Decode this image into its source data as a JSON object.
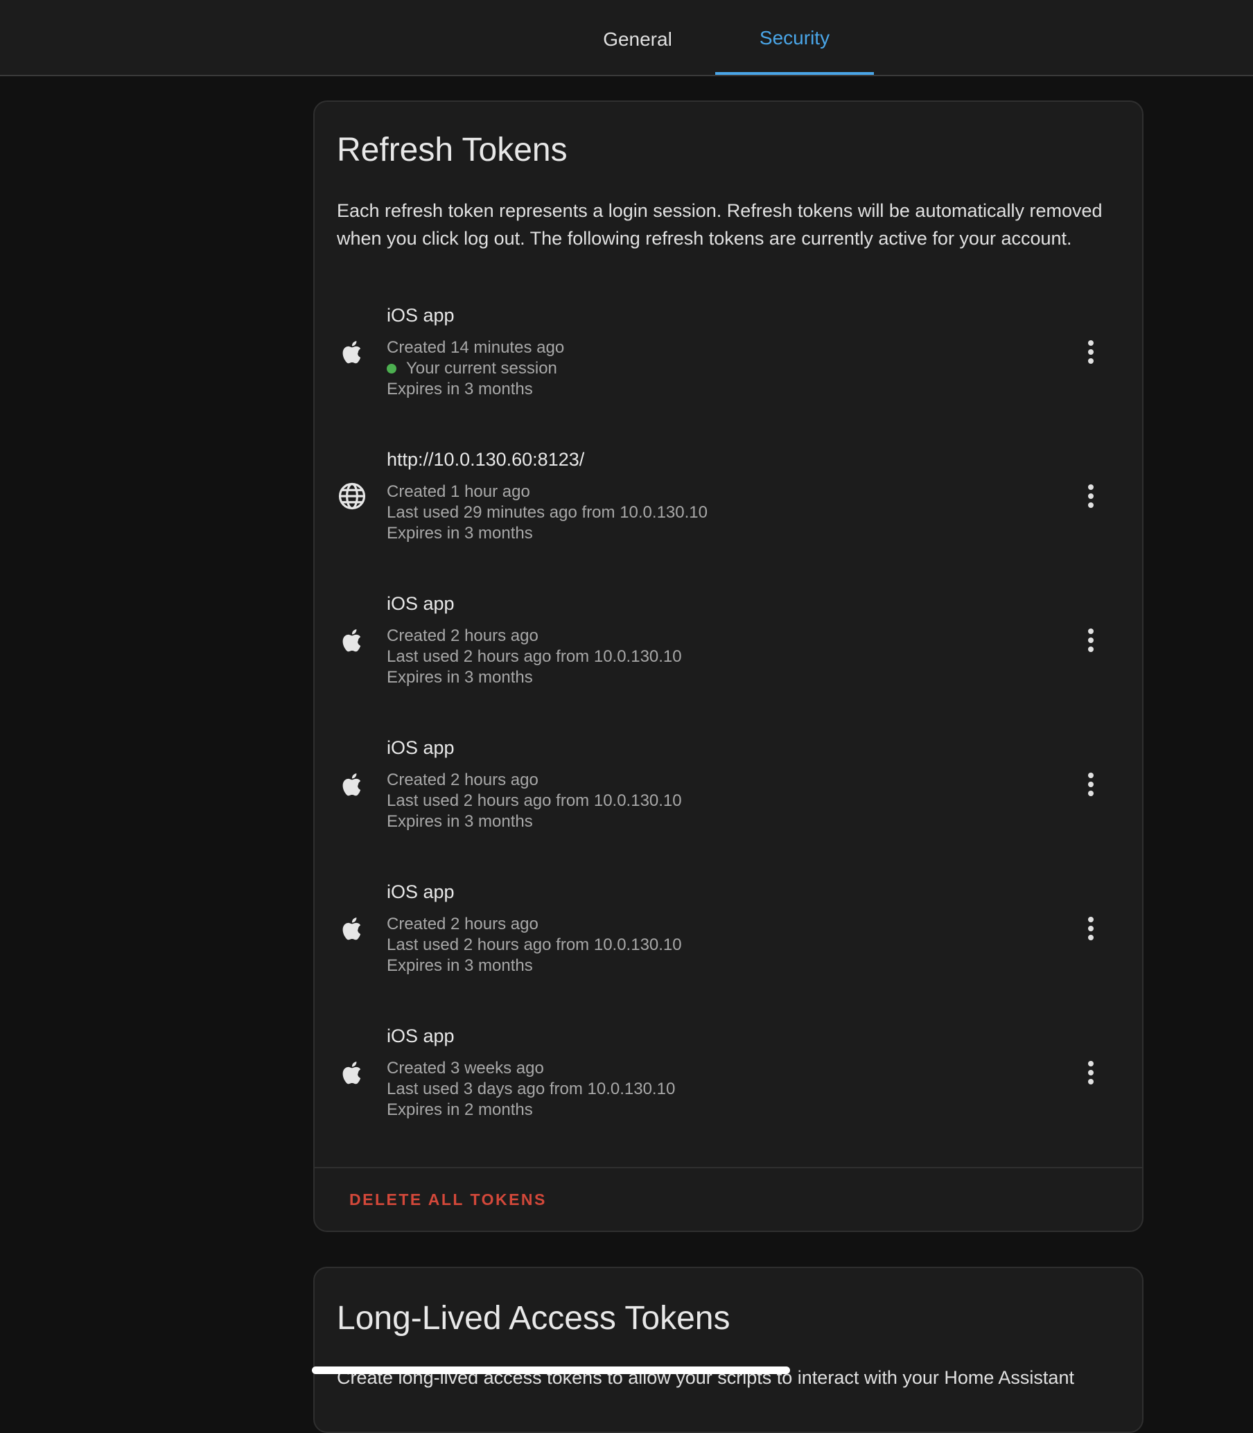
{
  "tabs": {
    "general": "General",
    "security": "Security"
  },
  "refresh_tokens": {
    "title": "Refresh Tokens",
    "description": "Each refresh token represents a login session. Refresh tokens will be automatically removed when you click log out. The following refresh tokens are currently active for your account.",
    "tokens": [
      {
        "icon": "apple-icon",
        "name": "iOS app",
        "created": "Created 14 minutes ago",
        "current_session": "Your current session",
        "expires": "Expires in 3 months"
      },
      {
        "icon": "globe-icon",
        "name": "http://10.0.130.60:8123/",
        "created": "Created 1 hour ago",
        "last_used": "Last used 29 minutes ago from 10.0.130.10",
        "expires": "Expires in 3 months"
      },
      {
        "icon": "apple-icon",
        "name": "iOS app",
        "created": "Created 2 hours ago",
        "last_used": "Last used 2 hours ago from 10.0.130.10",
        "expires": "Expires in 3 months"
      },
      {
        "icon": "apple-icon",
        "name": "iOS app",
        "created": "Created 2 hours ago",
        "last_used": "Last used 2 hours ago from 10.0.130.10",
        "expires": "Expires in 3 months"
      },
      {
        "icon": "apple-icon",
        "name": "iOS app",
        "created": "Created 2 hours ago",
        "last_used": "Last used 2 hours ago from 10.0.130.10",
        "expires": "Expires in 3 months"
      },
      {
        "icon": "apple-icon",
        "name": "iOS app",
        "created": "Created 3 weeks ago",
        "last_used": "Last used 3 days ago from 10.0.130.10",
        "expires": "Expires in 2 months"
      }
    ],
    "delete_all_label": "DELETE ALL TOKENS"
  },
  "long_lived_tokens": {
    "title": "Long-Lived Access Tokens",
    "description": "Create long-lived access tokens to allow your scripts to interact with your Home Assistant"
  },
  "colors": {
    "accent": "#4aa6e8",
    "danger": "#d3483a",
    "session_dot": "#4caf50"
  }
}
